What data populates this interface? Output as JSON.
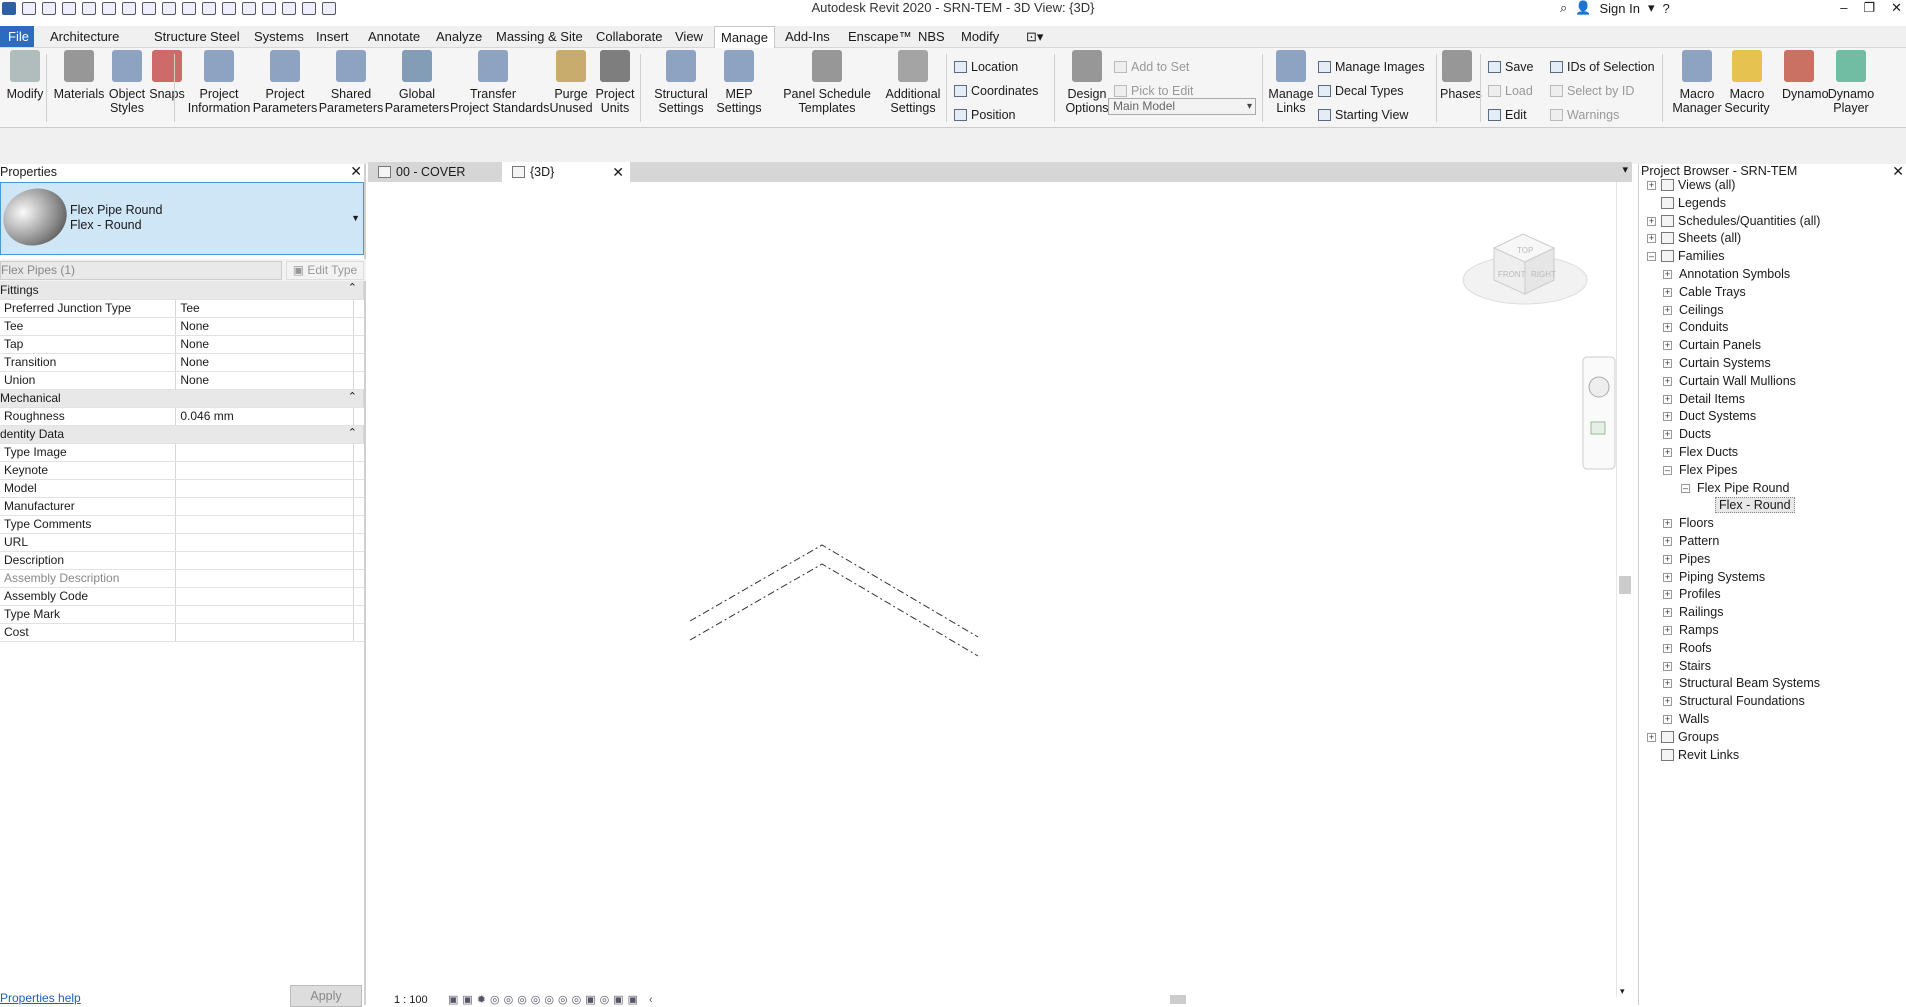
{
  "app": {
    "title": "Autodesk Revit 2020 - SRN-TEM - 3D View: {3D}",
    "sign_in": "Sign In"
  },
  "menu": {
    "tabs": [
      "File",
      "Architecture",
      "Structure",
      "Steel",
      "Systems",
      "Insert",
      "Annotate",
      "Analyze",
      "Massing & Site",
      "Collaborate",
      "View",
      "Manage",
      "Add-Ins",
      "Enscape™",
      "NBS",
      "Modify"
    ],
    "active": "Manage"
  },
  "ribbon": {
    "modify": "Modify",
    "materials": "Materials",
    "object_styles": [
      "Object",
      "Styles"
    ],
    "snaps": "Snaps",
    "project_information": [
      "Project",
      "Information"
    ],
    "project_parameters": [
      "Project",
      "Parameters"
    ],
    "shared_parameters": [
      "Shared",
      "Parameters"
    ],
    "global_parameters": [
      "Global",
      "Parameters"
    ],
    "transfer_standards": [
      "Transfer",
      "Project Standards"
    ],
    "purge_unused": [
      "Purge",
      "Unused"
    ],
    "project_units": [
      "Project",
      "Units"
    ],
    "structural_settings": [
      "Structural",
      "Settings"
    ],
    "mep_settings": [
      "MEP",
      "Settings"
    ],
    "panel_schedule_templates": [
      "Panel Schedule",
      "Templates"
    ],
    "additional_settings": [
      "Additional",
      "Settings"
    ],
    "location": "Location",
    "coordinates": "Coordinates",
    "position": "Position",
    "design_options": [
      "Design",
      "Options"
    ],
    "add_to_set": "Add to Set",
    "pick_to_edit": "Pick to Edit",
    "main_model": "Main Model",
    "manage_links": [
      "Manage",
      "Links"
    ],
    "manage_images": "Manage  Images",
    "decal_types": "Decal  Types",
    "starting_view": "Starting  View",
    "phases": "Phases",
    "save": "Save",
    "load": "Load",
    "edit": "Edit",
    "ids_of_selection": "IDs of  Selection",
    "select_by_id": "Select  by ID",
    "warnings": "Warnings",
    "macro_manager": [
      "Macro",
      "Manager"
    ],
    "macro_security": [
      "Macro",
      "Security"
    ],
    "dynamo": "Dynamo",
    "dynamo_player": [
      "Dynamo",
      "Player"
    ]
  },
  "properties": {
    "title": "Properties",
    "type_family": "Flex Pipe Round",
    "type_name": "Flex - Round",
    "filter": "Flex Pipes (1)",
    "edit_type": "Edit Type",
    "groups": [
      {
        "name": "Fittings",
        "rows": [
          {
            "k": "Preferred Junction Type",
            "v": "Tee"
          },
          {
            "k": "Tee",
            "v": "None"
          },
          {
            "k": "Tap",
            "v": "None"
          },
          {
            "k": "Transition",
            "v": "None"
          },
          {
            "k": "Union",
            "v": "None"
          }
        ]
      },
      {
        "name": "Mechanical",
        "rows": [
          {
            "k": "Roughness",
            "v": "0.046 mm"
          }
        ]
      },
      {
        "name": "dentity Data",
        "rows": [
          {
            "k": "Type Image",
            "v": ""
          },
          {
            "k": "Keynote",
            "v": ""
          },
          {
            "k": "Model",
            "v": ""
          },
          {
            "k": "Manufacturer",
            "v": ""
          },
          {
            "k": "Type Comments",
            "v": ""
          },
          {
            "k": "URL",
            "v": ""
          },
          {
            "k": "Description",
            "v": ""
          },
          {
            "k": "Assembly Description",
            "v": "",
            "dim": true
          },
          {
            "k": "Assembly Code",
            "v": ""
          },
          {
            "k": "Type Mark",
            "v": ""
          },
          {
            "k": "Cost",
            "v": ""
          }
        ]
      }
    ],
    "help": "Properties help",
    "apply": "Apply"
  },
  "view_tabs": [
    {
      "label": "00 - COVER"
    },
    {
      "label": "{3D}"
    }
  ],
  "view": {
    "scale": "1 : 100",
    "viewcube": {
      "top": "TOP",
      "front": "FRONT",
      "right": "RIGHT"
    }
  },
  "browser": {
    "title": "Project Browser - SRN-TEM",
    "nodes": [
      {
        "label": "Views (all)",
        "level": 0,
        "expander": "+",
        "icon": true
      },
      {
        "label": "Legends",
        "level": 0,
        "expander": "",
        "icon": true
      },
      {
        "label": "Schedules/Quantities (all)",
        "level": 0,
        "expander": "+",
        "icon": true
      },
      {
        "label": "Sheets (all)",
        "level": 0,
        "expander": "+",
        "icon": true
      },
      {
        "label": "Families",
        "level": 0,
        "expander": "-",
        "icon": true
      },
      {
        "label": "Annotation Symbols",
        "level": 1,
        "expander": "+"
      },
      {
        "label": "Cable Trays",
        "level": 1,
        "expander": "+"
      },
      {
        "label": "Ceilings",
        "level": 1,
        "expander": "+"
      },
      {
        "label": "Conduits",
        "level": 1,
        "expander": "+"
      },
      {
        "label": "Curtain Panels",
        "level": 1,
        "expander": "+"
      },
      {
        "label": "Curtain Systems",
        "level": 1,
        "expander": "+"
      },
      {
        "label": "Curtain Wall Mullions",
        "level": 1,
        "expander": "+"
      },
      {
        "label": "Detail Items",
        "level": 1,
        "expander": "+"
      },
      {
        "label": "Duct Systems",
        "level": 1,
        "expander": "+"
      },
      {
        "label": "Ducts",
        "level": 1,
        "expander": "+"
      },
      {
        "label": "Flex Ducts",
        "level": 1,
        "expander": "+"
      },
      {
        "label": "Flex Pipes",
        "level": 1,
        "expander": "-"
      },
      {
        "label": "Flex Pipe Round",
        "level": 2,
        "expander": "-"
      },
      {
        "label": "Flex - Round",
        "level": 3,
        "expander": "",
        "selected": true
      },
      {
        "label": "Floors",
        "level": 1,
        "expander": "+"
      },
      {
        "label": "Pattern",
        "level": 1,
        "expander": "+"
      },
      {
        "label": "Pipes",
        "level": 1,
        "expander": "+"
      },
      {
        "label": "Piping Systems",
        "level": 1,
        "expander": "+"
      },
      {
        "label": "Profiles",
        "level": 1,
        "expander": "+"
      },
      {
        "label": "Railings",
        "level": 1,
        "expander": "+"
      },
      {
        "label": "Ramps",
        "level": 1,
        "expander": "+"
      },
      {
        "label": "Roofs",
        "level": 1,
        "expander": "+"
      },
      {
        "label": "Stairs",
        "level": 1,
        "expander": "+"
      },
      {
        "label": "Structural Beam Systems",
        "level": 1,
        "expander": "+"
      },
      {
        "label": "Structural Foundations",
        "level": 1,
        "expander": "+"
      },
      {
        "label": "Walls",
        "level": 1,
        "expander": "+"
      },
      {
        "label": "Groups",
        "level": 0,
        "expander": "+",
        "icon": true
      },
      {
        "label": "Revit Links",
        "level": 0,
        "expander": "",
        "icon": true
      }
    ]
  }
}
